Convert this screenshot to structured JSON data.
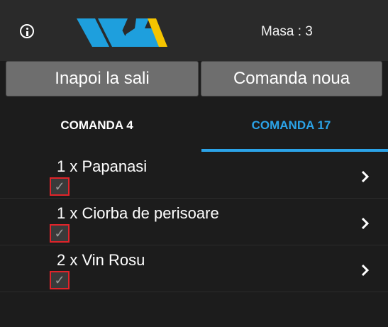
{
  "header": {
    "table_label": "Masa : 3",
    "icons": {
      "info": "info-icon",
      "logo": "brand-logo"
    },
    "logo_colors": {
      "blue": "#1e9fdd",
      "yellow": "#f5c400"
    }
  },
  "actions": {
    "back_label": "Inapoi la sali",
    "new_order_label": "Comanda noua"
  },
  "tabs": [
    {
      "label": "COMANDA 4",
      "active": false
    },
    {
      "label": "COMANDA 17",
      "active": true
    }
  ],
  "colors": {
    "accent": "#2ba3e8",
    "check_border": "#e0242a",
    "background": "#1c1c1c"
  },
  "items": [
    {
      "label": "1 x Papanasi",
      "checked": true,
      "check_glyph": "✓"
    },
    {
      "label": "1 x Ciorba de perisoare",
      "checked": true,
      "check_glyph": "✓"
    },
    {
      "label": "2 x Vin Rosu",
      "checked": true,
      "check_glyph": "✓"
    }
  ]
}
